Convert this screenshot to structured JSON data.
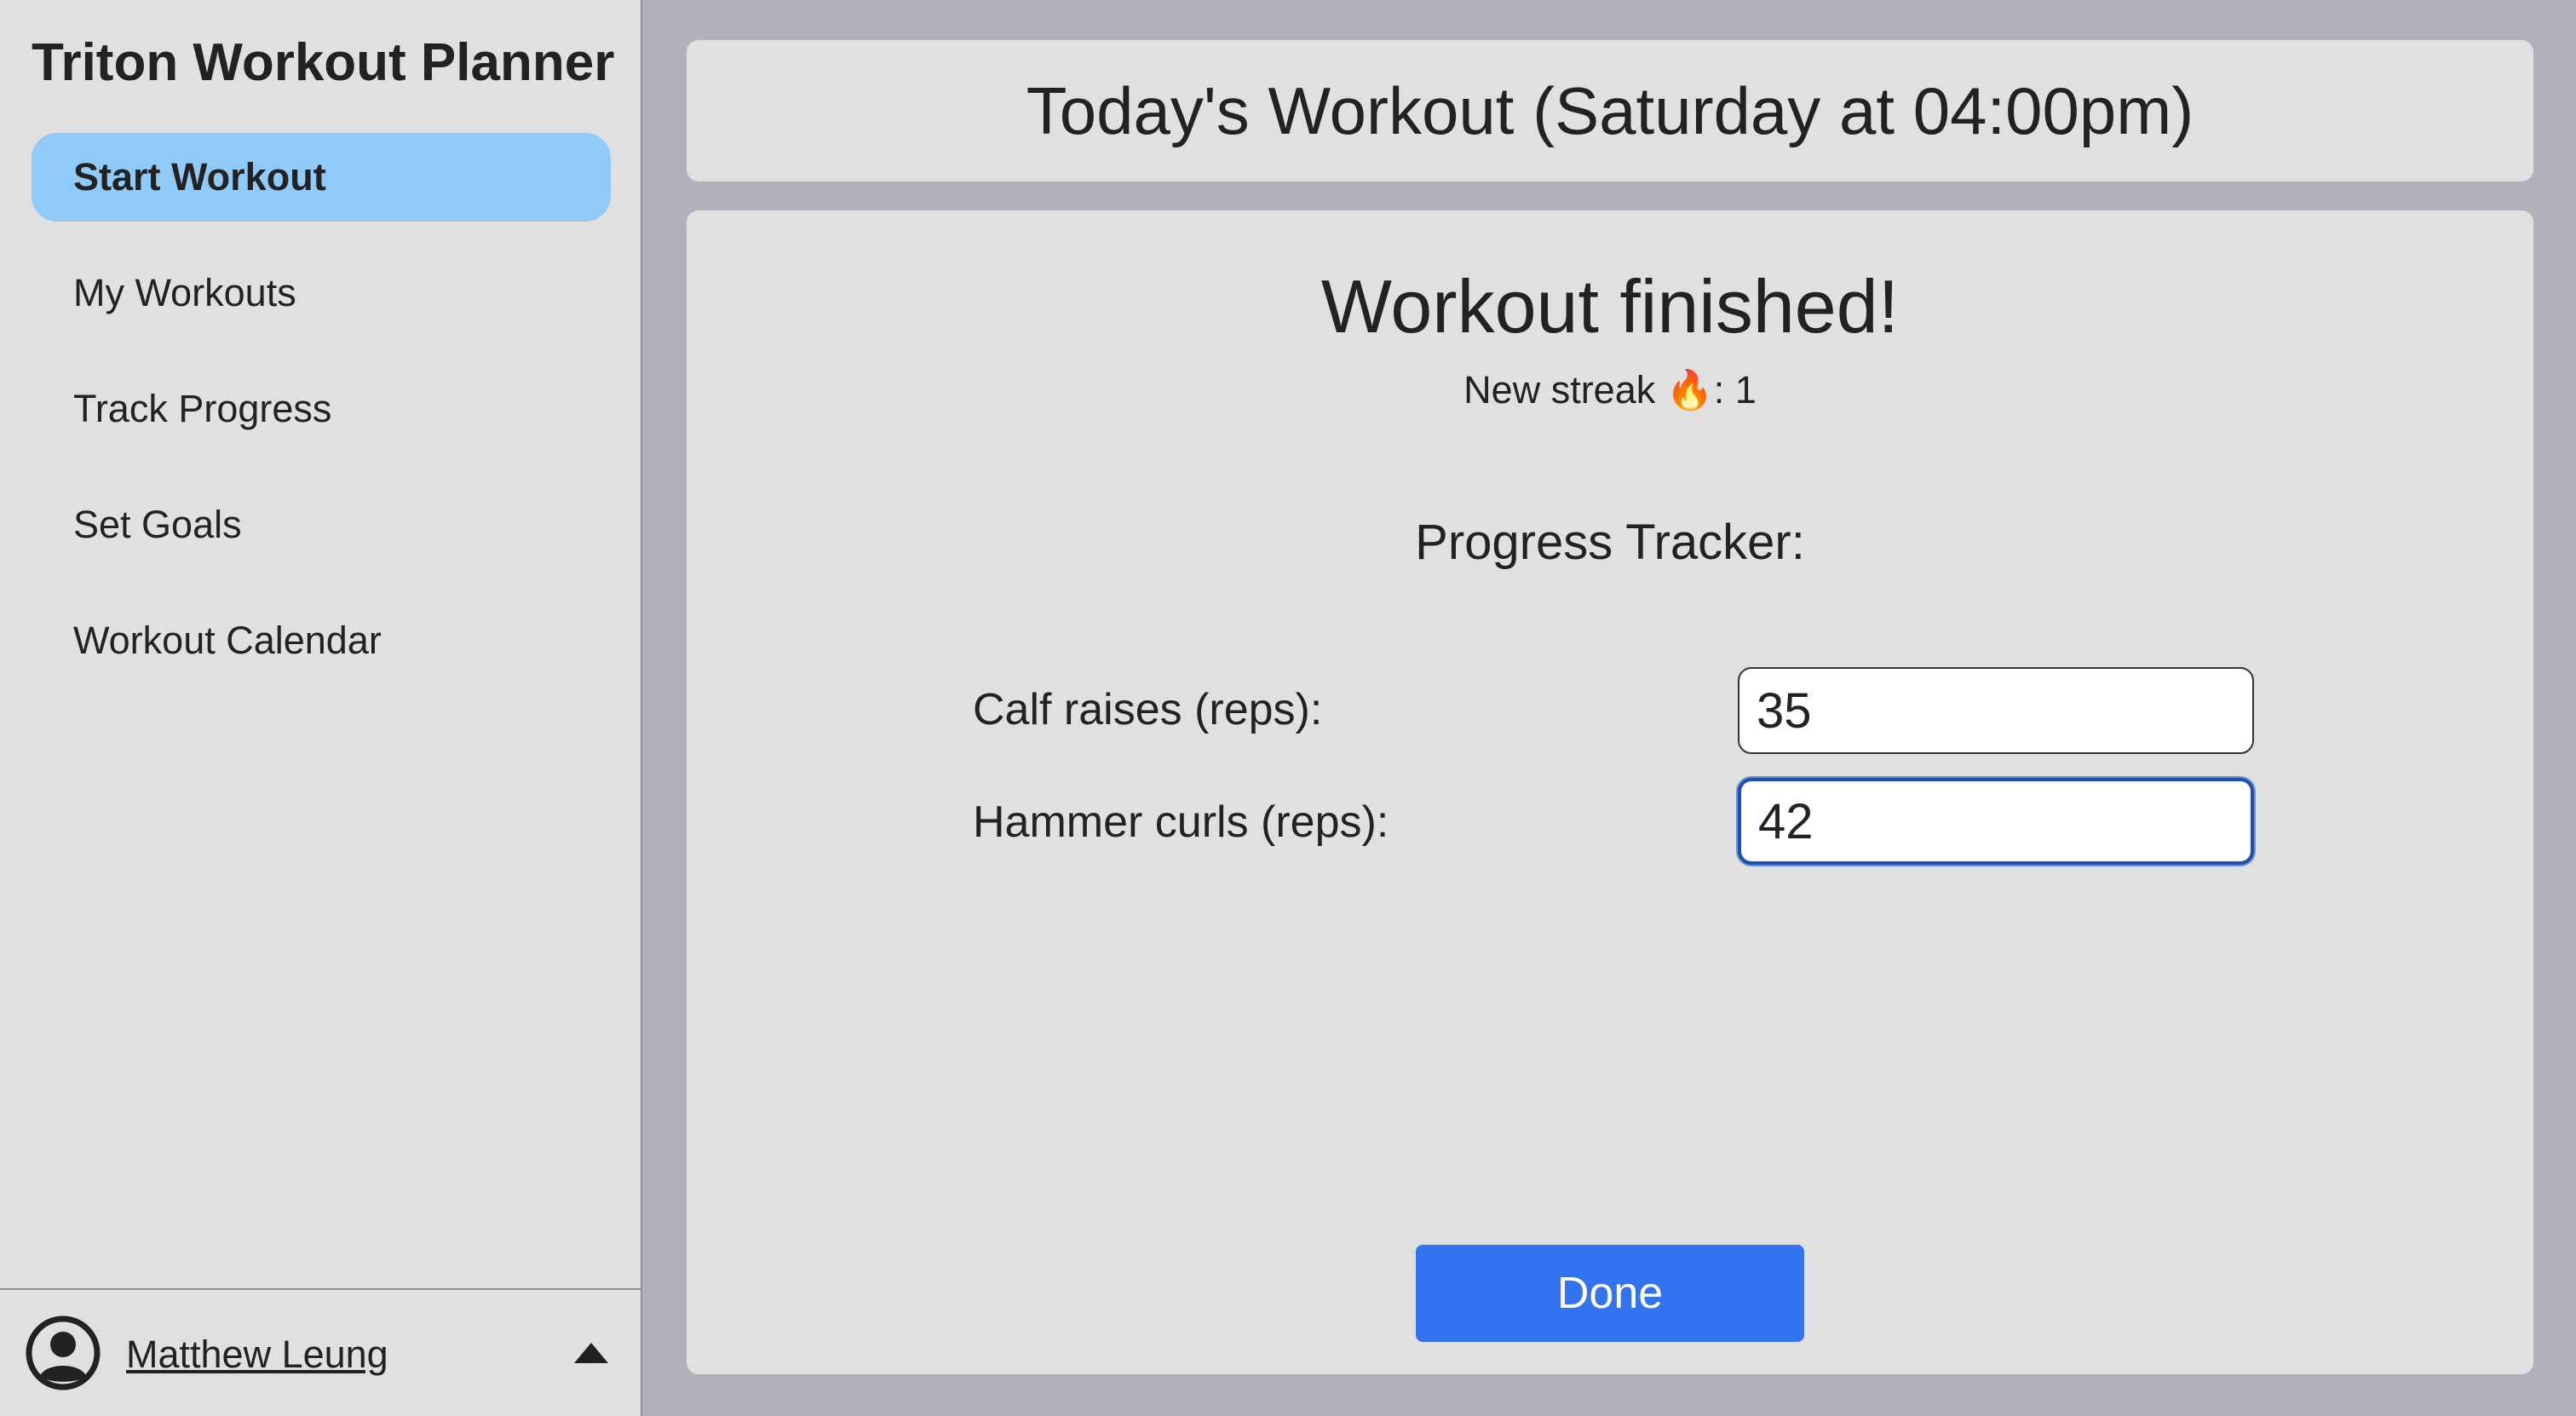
{
  "sidebar": {
    "app_title": "Triton Workout Planner",
    "items": [
      {
        "label": "Start Workout",
        "active": true
      },
      {
        "label": "My Workouts",
        "active": false
      },
      {
        "label": "Track Progress",
        "active": false
      },
      {
        "label": "Set Goals",
        "active": false
      },
      {
        "label": "Workout Calendar",
        "active": false
      }
    ],
    "user": {
      "name": "Matthew Leung",
      "icon": "user-circle-icon",
      "menu_icon": "caret-up-icon"
    }
  },
  "header": {
    "title": "Today's Workout (Saturday at 04:00pm)"
  },
  "main": {
    "heading": "Workout finished!",
    "streak_text": "New streak 🔥: 1",
    "tracker_title": "Progress Tracker:",
    "fields": [
      {
        "label": "Calf raises (reps):",
        "value": "35"
      },
      {
        "label": "Hammer curls (reps):",
        "value": "42"
      }
    ],
    "done_label": "Done"
  },
  "colors": {
    "active_nav": "#90caf9",
    "primary_button": "#3473ef",
    "panel": "#e0e0e0",
    "background": "#b0b1bb"
  }
}
